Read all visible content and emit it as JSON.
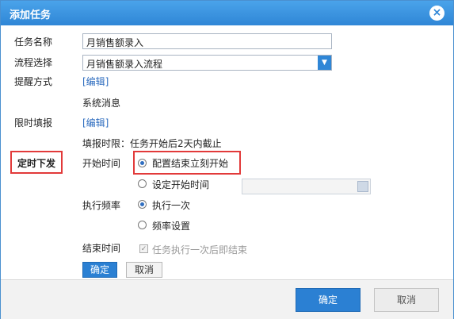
{
  "dialog": {
    "title": "添加任务",
    "close_icon": "close-icon"
  },
  "form": {
    "task_name": {
      "label": "任务名称",
      "value": "月销售额录入"
    },
    "process": {
      "label": "流程选择",
      "value": "月销售额录入流程"
    },
    "reminder": {
      "label": "提醒方式",
      "edit_link": "[编辑]",
      "value": "系统消息"
    },
    "deadline": {
      "label": "限时填报",
      "edit_link": "[编辑]",
      "summary": "填报时限：任务开始后2天内截止"
    },
    "scheduled": {
      "section_label": "定时下发",
      "start_time": {
        "label": "开始时间",
        "option_immediate": "配置结束立刻开始",
        "option_custom": "设定开始时间"
      },
      "frequency": {
        "label": "执行频率",
        "option_once": "执行一次",
        "option_setting": "频率设置"
      },
      "end_time": {
        "label": "结束时间",
        "checkbox_text": "任务执行一次后即结束"
      },
      "confirm_label": "确定",
      "cancel_label": "取消"
    }
  },
  "footer": {
    "ok_label": "确定",
    "cancel_label": "取消"
  },
  "colors": {
    "title_bar": "#3b95e0",
    "primary_button": "#2b80d3",
    "highlight_box": "#e23a3a",
    "link": "#2d6cbf"
  }
}
